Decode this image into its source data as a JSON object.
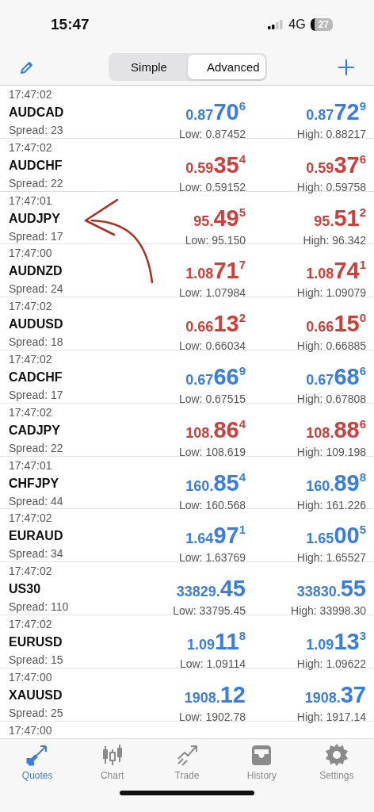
{
  "status_bar": {
    "time": "15:47",
    "network": "4G",
    "battery": "27"
  },
  "toolbar": {
    "segments": [
      {
        "label": "Simple",
        "selected": false
      },
      {
        "label": "Advanced",
        "selected": true
      }
    ]
  },
  "quotes": [
    {
      "time": "17:47:02",
      "symbol": "AUDCAD",
      "spread": "Spread: 23",
      "color": "#3b7ddd",
      "bid": {
        "prefix": "0.87",
        "big": "70",
        "sup": "6"
      },
      "ask": {
        "prefix": "0.87",
        "big": "72",
        "sup": "9"
      },
      "low": "Low: 0.87452",
      "high": "High: 0.88217"
    },
    {
      "time": "17:47:02",
      "symbol": "AUDCHF",
      "spread": "Spread: 22",
      "color": "#c8413a",
      "bid": {
        "prefix": "0.59",
        "big": "35",
        "sup": "4"
      },
      "ask": {
        "prefix": "0.59",
        "big": "37",
        "sup": "6"
      },
      "low": "Low: 0.59152",
      "high": "High: 0.59758"
    },
    {
      "time": "17:47:01",
      "symbol": "AUDJPY",
      "spread": "Spread: 17",
      "color": "#c8413a",
      "bid": {
        "prefix": "95.",
        "big": "49",
        "sup": "5"
      },
      "ask": {
        "prefix": "95.",
        "big": "51",
        "sup": "2"
      },
      "low": "Low: 95.150",
      "high": "High: 96.342"
    },
    {
      "time": "17:47:00",
      "symbol": "AUDNZD",
      "spread": "Spread: 24",
      "color": "#c8413a",
      "bid": {
        "prefix": "1.08",
        "big": "71",
        "sup": "7"
      },
      "ask": {
        "prefix": "1.08",
        "big": "74",
        "sup": "1"
      },
      "low": "Low: 1.07984",
      "high": "High: 1.09079"
    },
    {
      "time": "17:47:02",
      "symbol": "AUDUSD",
      "spread": "Spread: 18",
      "color": "#c8413a",
      "bid": {
        "prefix": "0.66",
        "big": "13",
        "sup": "2"
      },
      "ask": {
        "prefix": "0.66",
        "big": "15",
        "sup": "0"
      },
      "low": "Low: 0.66034",
      "high": "High: 0.66885"
    },
    {
      "time": "17:47:02",
      "symbol": "CADCHF",
      "spread": "Spread: 17",
      "color": "#3b7ddd",
      "bid": {
        "prefix": "0.67",
        "big": "66",
        "sup": "9"
      },
      "ask": {
        "prefix": "0.67",
        "big": "68",
        "sup": "6"
      },
      "low": "Low: 0.67515",
      "high": "High: 0.67808"
    },
    {
      "time": "17:47:02",
      "symbol": "CADJPY",
      "spread": "Spread: 22",
      "color": "#c8413a",
      "bid": {
        "prefix": "108.",
        "big": "86",
        "sup": "4"
      },
      "ask": {
        "prefix": "108.",
        "big": "88",
        "sup": "6"
      },
      "low": "Low: 108.619",
      "high": "High: 109.198"
    },
    {
      "time": "17:47:01",
      "symbol": "CHFJPY",
      "spread": "Spread: 44",
      "color": "#3b7ddd",
      "bid": {
        "prefix": "160.",
        "big": "85",
        "sup": "4"
      },
      "ask": {
        "prefix": "160.",
        "big": "89",
        "sup": "8"
      },
      "low": "Low: 160.568",
      "high": "High: 161.226"
    },
    {
      "time": "17:47:02",
      "symbol": "EURAUD",
      "spread": "Spread: 34",
      "color": "#3b7ddd",
      "bid": {
        "prefix": "1.64",
        "big": "97",
        "sup": "1"
      },
      "ask": {
        "prefix": "1.65",
        "big": "00",
        "sup": "5"
      },
      "low": "Low: 1.63769",
      "high": "High: 1.65527"
    },
    {
      "time": "17:47:02",
      "symbol": "US30",
      "spread": "Spread: 110",
      "color": "#3b7ddd",
      "bid": {
        "prefix": "33829.",
        "big": "45"
      },
      "ask": {
        "prefix": "33830.",
        "big": "55"
      },
      "low": "Low: 33795.45",
      "high": "High: 33998.30"
    },
    {
      "time": "17:47:02",
      "symbol": "EURUSD",
      "spread": "Spread: 15",
      "color": "#3b7ddd",
      "bid": {
        "prefix": "1.09",
        "big": "11",
        "sup": "8"
      },
      "ask": {
        "prefix": "1.09",
        "big": "13",
        "sup": "3"
      },
      "low": "Low: 1.09114",
      "high": "High: 1.09622"
    },
    {
      "time": "17:47:00",
      "symbol": "XAUUSD",
      "spread": "Spread: 25",
      "color": "#3b7ddd",
      "bid": {
        "prefix": "1908.",
        "big": "12"
      },
      "ask": {
        "prefix": "1908.",
        "big": "37"
      },
      "low": "Low: 1902.78",
      "high": "High: 1917.14"
    },
    {
      "time": "17:47:00"
    }
  ],
  "tab_bar": [
    {
      "label": "Quotes",
      "selected": true
    },
    {
      "label": "Chart",
      "selected": false
    },
    {
      "label": "Trade",
      "selected": false
    },
    {
      "label": "History",
      "selected": false
    },
    {
      "label": "Settings",
      "selected": false
    }
  ]
}
